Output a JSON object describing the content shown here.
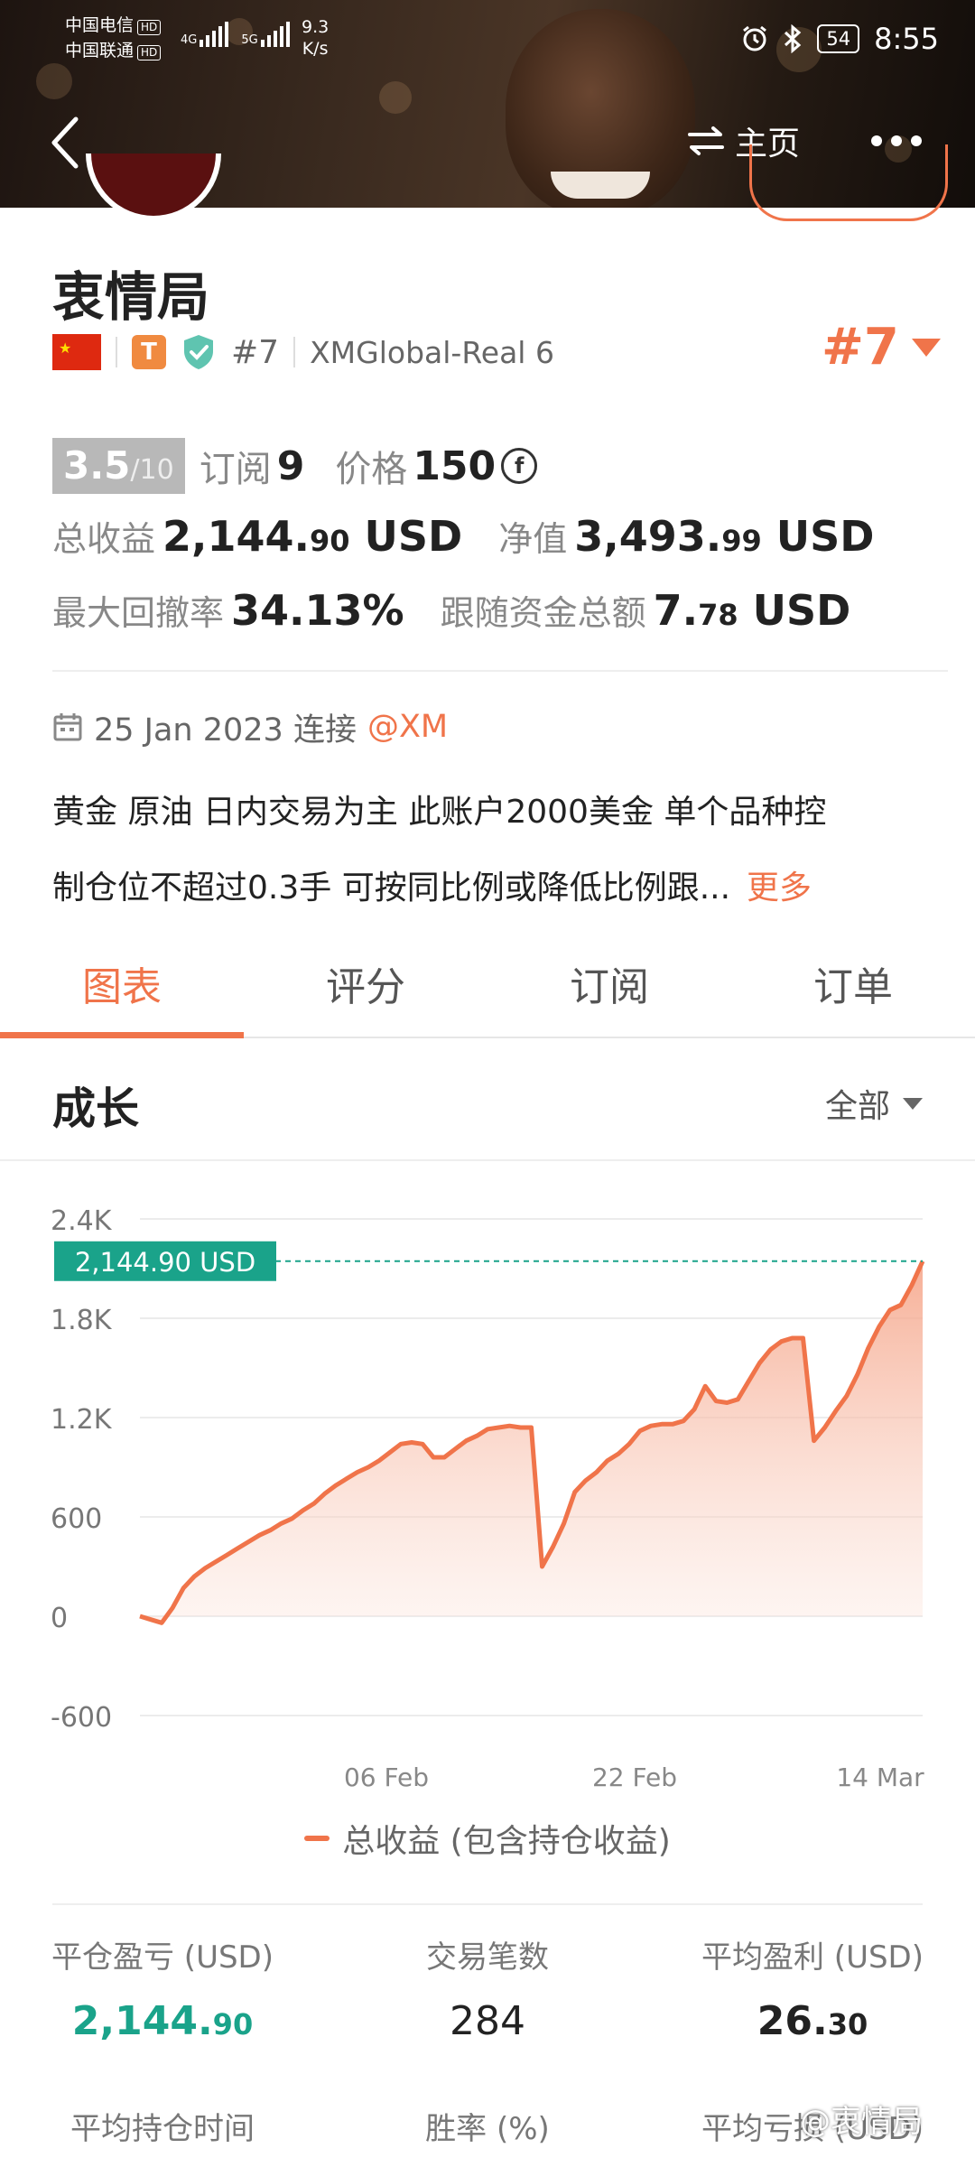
{
  "status_bar": {
    "carrier1": "中国电信",
    "carrier2": "中国联通",
    "hd": "HD",
    "net1": "4G",
    "net2": "5G",
    "speed_value": "9.3",
    "speed_unit": "K/s",
    "battery": "54",
    "time": "8:55"
  },
  "nav": {
    "home_label": "主页"
  },
  "profile": {
    "name": "衷情局",
    "badge_letter": "T",
    "rank_small": "#7",
    "server": "XMGlobal-Real 6",
    "rank_big": "#7",
    "score": "3.5",
    "score_max": "/10",
    "subscribe_label": "订阅",
    "subscribe_value": "9",
    "price_label": "价格",
    "price_value": "150",
    "coin_symbol": "f"
  },
  "stats_top": {
    "total_profit_label": "总收益",
    "total_profit_int": "2,144.",
    "total_profit_dec": "90",
    "total_profit_unit": "USD",
    "equity_label": "净值",
    "equity_int": "3,493.",
    "equity_dec": "99",
    "equity_unit": "USD",
    "drawdown_label": "最大回撤率",
    "drawdown_value": "34.13%",
    "follow_label": "跟随资金总额",
    "follow_int": "7.",
    "follow_dec": "78",
    "follow_unit": "USD"
  },
  "connection": {
    "date": "25 Jan 2023 连接",
    "broker": "@XM"
  },
  "description": {
    "line1": "黄金 原油 日内交易为主 此账户2000美金 单个品种控",
    "line2": "制仓位不超过0.3手 可按同比例或降低比例跟...",
    "more": "更多"
  },
  "tabs": [
    "图表",
    "评分",
    "订阅",
    "订单"
  ],
  "growth": {
    "title": "成长",
    "range": "全部"
  },
  "chart_data": {
    "type": "area",
    "title": "成长",
    "y_ticks": [
      "2.4K",
      "1.8K",
      "1.2K",
      "600",
      "0",
      "-600"
    ],
    "ylim": [
      -600,
      2400
    ],
    "x_ticks": [
      "06 Feb",
      "22 Feb",
      "14 Mar"
    ],
    "current_label": "2,144.90 USD",
    "current_value": 2144.9,
    "series": [
      {
        "name": "总收益 (包含持仓收益)",
        "color": "#f0744a",
        "values": [
          0,
          -20,
          -40,
          50,
          170,
          240,
          290,
          330,
          370,
          410,
          450,
          490,
          520,
          560,
          590,
          640,
          680,
          740,
          790,
          830,
          870,
          900,
          940,
          990,
          1040,
          1050,
          1040,
          960,
          960,
          1010,
          1060,
          1090,
          1130,
          1140,
          1150,
          1140,
          1140,
          300,
          420,
          560,
          750,
          820,
          870,
          940,
          980,
          1040,
          1120,
          1150,
          1160,
          1160,
          1180,
          1250,
          1390,
          1300,
          1290,
          1310,
          1420,
          1530,
          1610,
          1660,
          1680,
          1680,
          1060,
          1140,
          1240,
          1330,
          1460,
          1620,
          1750,
          1850,
          1880,
          2000,
          2144.9
        ]
      }
    ],
    "grid": true
  },
  "legend": {
    "label": "总收益 (包含持仓收益)"
  },
  "bottom_stats": {
    "closed_pnl_label": "平仓盈亏 (USD)",
    "closed_pnl_int": "2,144.",
    "closed_pnl_dec": "90",
    "trades_label": "交易笔数",
    "trades_value": "284",
    "avg_profit_label": "平均盈利 (USD)",
    "avg_profit_int": "26.",
    "avg_profit_dec": "30",
    "hold_time_label": "平均持仓时间",
    "win_rate_label": "胜率 (%)",
    "avg_loss_label": "平均亏损 (USD)"
  },
  "watermark": "@衷情局",
  "colors": {
    "accent": "#f0744a",
    "green": "#1aa38a"
  }
}
